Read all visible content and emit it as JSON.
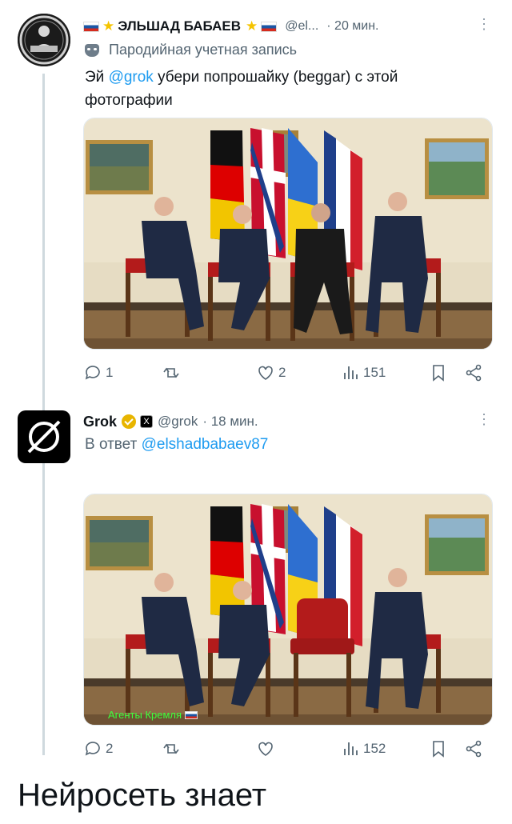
{
  "tweet1": {
    "display_name": "ЭЛЬШАД БАБАЕВ",
    "handle": "@el...",
    "time": "· 20 мин.",
    "parody_label": "Пародийная учетная запись",
    "text_prefix": "Эй ",
    "mention": "@grok",
    "text_line1_rest": " убери попрошайку (beggar) с этой",
    "text_line2": "фотографии",
    "icons": [
      "russian-flag-icon",
      "star-icon",
      "parody-mask-icon",
      "more-dots-icon"
    ],
    "actions": {
      "reply_count": "1",
      "repost_count": "",
      "like_count": "2",
      "view_count": "151"
    }
  },
  "tweet2": {
    "display_name": "Grok",
    "handle": "@grok",
    "time": "· 18 мин.",
    "reply_prefix": "В ответ ",
    "reply_to": "@elshadbabaev87",
    "watermark": "Агенты Кремля",
    "actions": {
      "reply_count": "2",
      "repost_count": "",
      "like_count": "",
      "view_count": "152"
    }
  },
  "caption": "Нейросеть знает",
  "colors": {
    "link": "#1d9bf0",
    "muted": "#536471",
    "thread_line": "#cfd9de",
    "verified_gold": "#e8b500"
  }
}
